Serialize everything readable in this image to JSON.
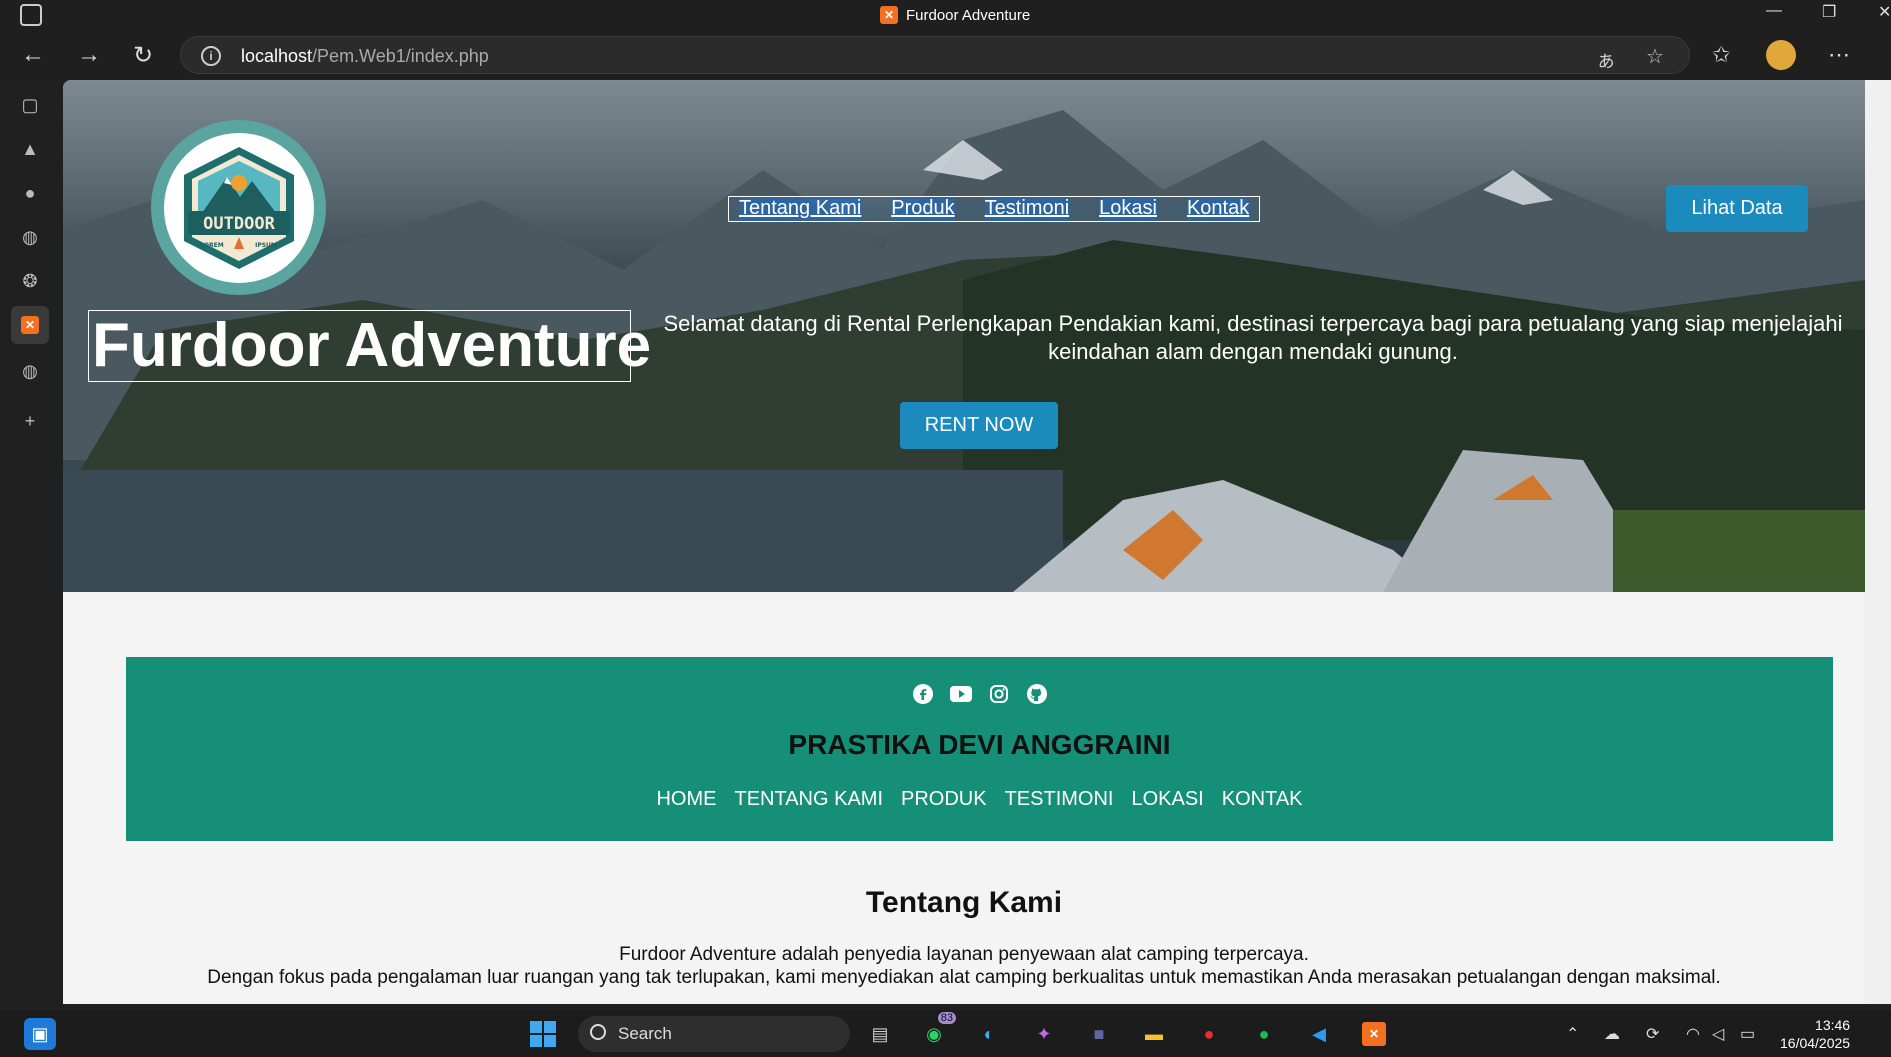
{
  "window": {
    "title": "Furdoor Adventure"
  },
  "browser": {
    "url_host": "localhost",
    "url_path": "/Pem.Web1/index.php"
  },
  "hero": {
    "nav": [
      "Tentang Kami",
      "Produk",
      "Testimoni",
      "Lokasi",
      "Kontak"
    ],
    "lihat_data": "Lihat Data",
    "title": "Furdoor Adventure",
    "description": "Selamat datang di Rental Perlengkapan Pendakian kami, destinasi terpercaya bagi para petualang yang siap menjelajahi keindahan alam dengan mendaki gunung.",
    "rent_button": "RENT NOW",
    "logo_text": "OUTDOOR",
    "logo_sub_left": "LOREM",
    "logo_sub_right": "IPSUM"
  },
  "panel": {
    "social_icons": [
      "facebook-icon",
      "youtube-icon",
      "instagram-icon",
      "github-icon"
    ],
    "name": "PRASTIKA DEVI ANGGRAINI",
    "nav": [
      "HOME",
      "TENTANG KAMI",
      "PRODUK",
      "TESTIMONI",
      "LOKASI",
      "KONTAK"
    ]
  },
  "about": {
    "title": "Tentang Kami",
    "line1": "Furdoor Adventure adalah penyedia layanan penyewaan alat camping terpercaya.",
    "line2": "Dengan fokus pada pengalaman luar ruangan yang tak terlupakan, kami menyediakan alat camping berkualitas untuk memastikan Anda merasakan petualangan dengan maksimal."
  },
  "taskbar": {
    "search_label": "Search",
    "whatsapp_badge": "83",
    "time": "13:46",
    "date": "16/04/2025"
  },
  "colors": {
    "accent_button": "#1b8bbd",
    "panel_green": "#168f78"
  }
}
